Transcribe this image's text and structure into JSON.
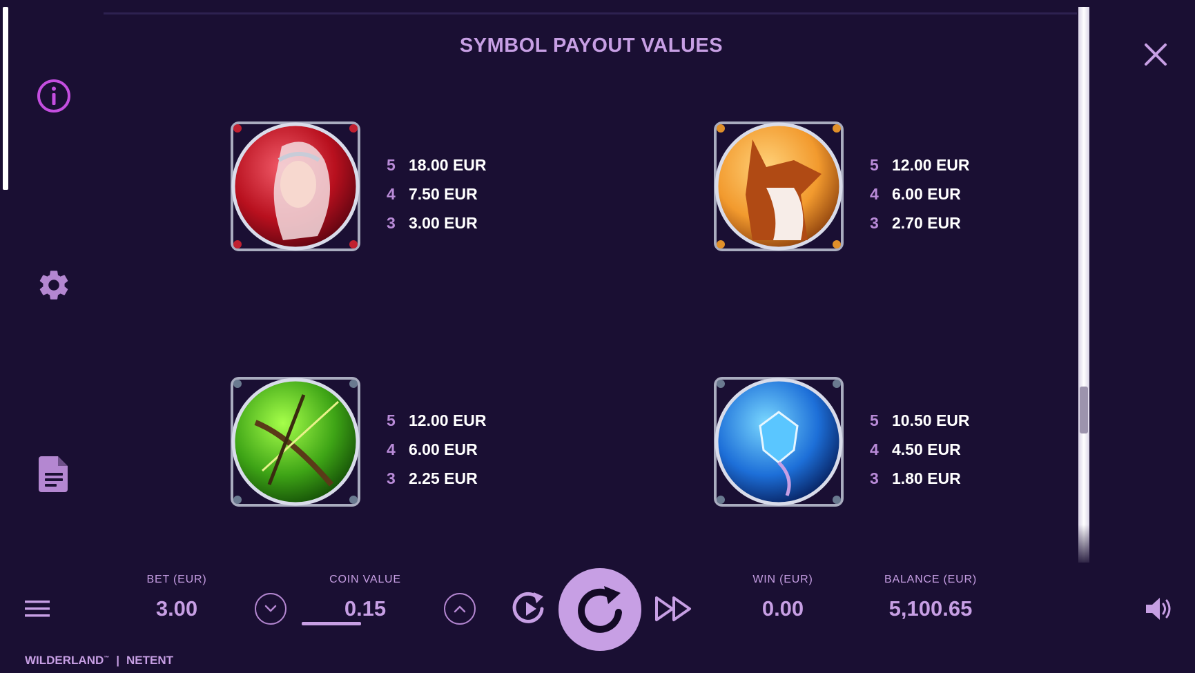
{
  "title": "SYMBOL PAYOUT VALUES",
  "side_icons": [
    "info-icon",
    "gear-icon",
    "document-icon"
  ],
  "symbols": [
    {
      "name": "elf-symbol",
      "colors": [
        "#f25c6a",
        "#b8101e",
        "#5a0410"
      ],
      "pays": [
        {
          "count": "5",
          "value": "18.00 EUR"
        },
        {
          "count": "4",
          "value": "7.50 EUR"
        },
        {
          "count": "3",
          "value": "3.00 EUR"
        }
      ]
    },
    {
      "name": "fox-symbol",
      "colors": [
        "#ffd27a",
        "#f29a2e",
        "#8a3e0c"
      ],
      "pays": [
        {
          "count": "5",
          "value": "12.00 EUR"
        },
        {
          "count": "4",
          "value": "6.00 EUR"
        },
        {
          "count": "3",
          "value": "2.70 EUR"
        }
      ]
    },
    {
      "name": "bow-symbol",
      "colors": [
        "#a6ff4a",
        "#3ea416",
        "#124a06"
      ],
      "pays": [
        {
          "count": "5",
          "value": "12.00 EUR"
        },
        {
          "count": "4",
          "value": "6.00 EUR"
        },
        {
          "count": "3",
          "value": "2.25 EUR"
        }
      ]
    },
    {
      "name": "gem-symbol",
      "colors": [
        "#7ad8ff",
        "#1d6fd8",
        "#061d5a"
      ],
      "pays": [
        {
          "count": "5",
          "value": "10.50 EUR"
        },
        {
          "count": "4",
          "value": "4.50 EUR"
        },
        {
          "count": "3",
          "value": "1.80 EUR"
        }
      ]
    }
  ],
  "bottom": {
    "bet_label": "BET (EUR)",
    "bet_value": "3.00",
    "coin_label": "COIN VALUE",
    "coin_value": "0.15",
    "win_label": "WIN (EUR)",
    "win_value": "0.00",
    "balance_label": "BALANCE (EUR)",
    "balance_value": "5,100.65"
  },
  "brand": {
    "game": "WILDERLAND",
    "tm": "™",
    "separator": "|",
    "provider": "NETENT"
  },
  "colors": {
    "background": "#1a0f33",
    "accent": "#c79fe4",
    "muted_accent": "#b98bd8",
    "text": "#ffffff"
  }
}
